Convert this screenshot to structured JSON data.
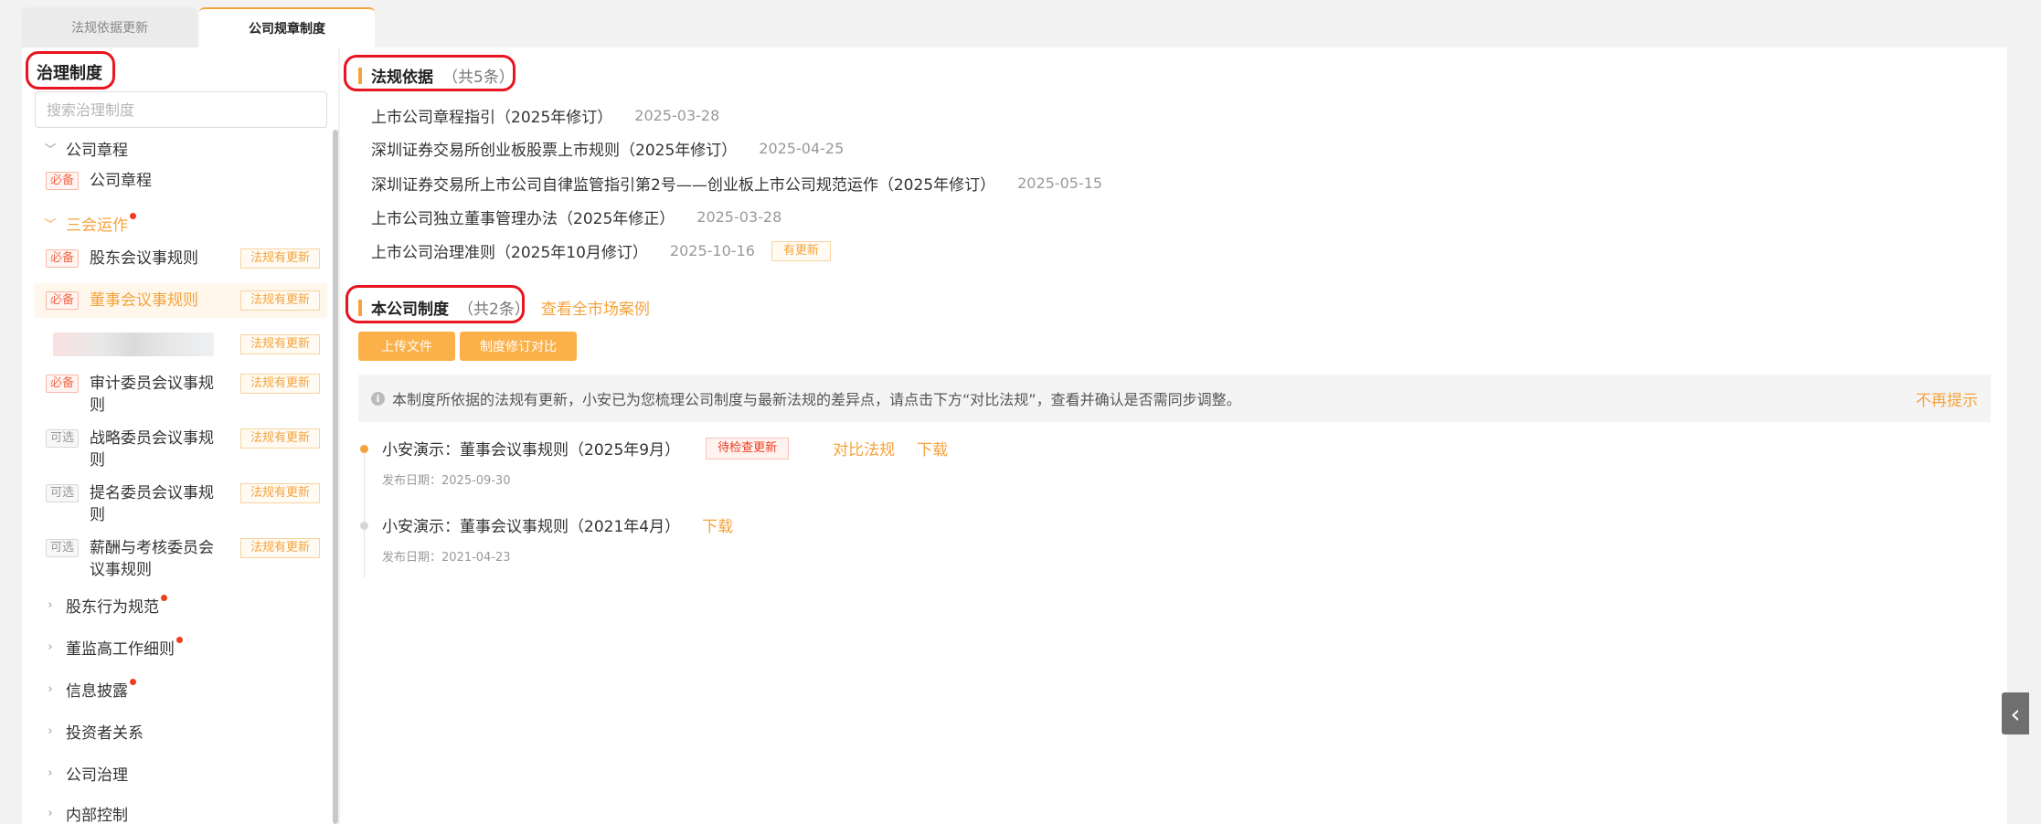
{
  "tabs": [
    {
      "label": "法规依据更新",
      "active": false
    },
    {
      "label": "公司规章制度",
      "active": true
    }
  ],
  "sidebar": {
    "title": "治理制度",
    "search_placeholder": "搜索治理制度",
    "groups": {
      "charter": {
        "label": "公司章程"
      },
      "three_meetings": {
        "label": "三会运作"
      },
      "shareholder_behavior": {
        "label": "股东行为规范"
      },
      "dse_rules": {
        "label": "董监高工作细则"
      },
      "disclosure": {
        "label": "信息披露"
      },
      "investor": {
        "label": "投资者关系"
      },
      "governance": {
        "label": "公司治理"
      },
      "internal_control": {
        "label": "内部控制"
      }
    },
    "items": {
      "charter": {
        "tag": "必备",
        "name": "公司章程"
      },
      "shareholder": {
        "tag": "必备",
        "name": "股东会议事规则",
        "badge": "法规有更新"
      },
      "board": {
        "tag": "必备",
        "name": "董事会议事规则",
        "badge": "法规有更新"
      },
      "blurred": {
        "badge": "法规有更新"
      },
      "audit": {
        "tag": "必备",
        "name": "审计委员会议事规则",
        "badge": "法规有更新"
      },
      "strategy": {
        "tag": "可选",
        "name": "战略委员会议事规则",
        "badge": "法规有更新"
      },
      "nomination": {
        "tag": "可选",
        "name": "提名委员会议事规则",
        "badge": "法规有更新"
      },
      "compensation": {
        "tag": "可选",
        "name": "薪酬与考核委员会议事规则",
        "badge": "法规有更新"
      }
    }
  },
  "laws": {
    "title": "法规依据",
    "count": "（共5条）",
    "items": [
      {
        "name": "上市公司章程指引（2025年修订）",
        "date": "2025-03-28"
      },
      {
        "name": "深圳证券交易所创业板股票上市规则（2025年修订）",
        "date": "2025-04-25"
      },
      {
        "name": "深圳证券交易所上市公司自律监管指引第2号——创业板上市公司规范运作（2025年修订）",
        "date": "2025-05-15"
      },
      {
        "name": "上市公司独立董事管理办法（2025年修正）",
        "date": "2025-03-28"
      },
      {
        "name": "上市公司治理准则（2025年10月修订）",
        "date": "2025-10-16",
        "badge": "有更新"
      }
    ]
  },
  "company": {
    "title": "本公司制度",
    "count": "（共2条）",
    "view_cases": "查看全市场案例",
    "upload_label": "上传文件",
    "compare_label": "制度修订对比",
    "notice": "本制度所依据的法规有更新，小安已为您梳理公司制度与最新法规的差异点，请点击下方“对比法规”，查看并确认是否需同步调整。",
    "dismiss": "不再提示",
    "docs": [
      {
        "name": "小安演示：董事会议事规则（2025年9月）",
        "status": "待检查更新",
        "compare": "对比法规",
        "download": "下载",
        "date_label": "发布日期：2025-09-30"
      },
      {
        "name": "小安演示：董事会议事规则（2021年4月）",
        "download": "下载",
        "date_label": "发布日期：2021-04-23"
      }
    ]
  },
  "colors": {
    "accent": "#f5a33c",
    "annotation": "#e8141e",
    "alert": "#f03c1f"
  },
  "icons": {
    "collapse_toggle": "chevron-left-icon",
    "info": "info-icon"
  }
}
